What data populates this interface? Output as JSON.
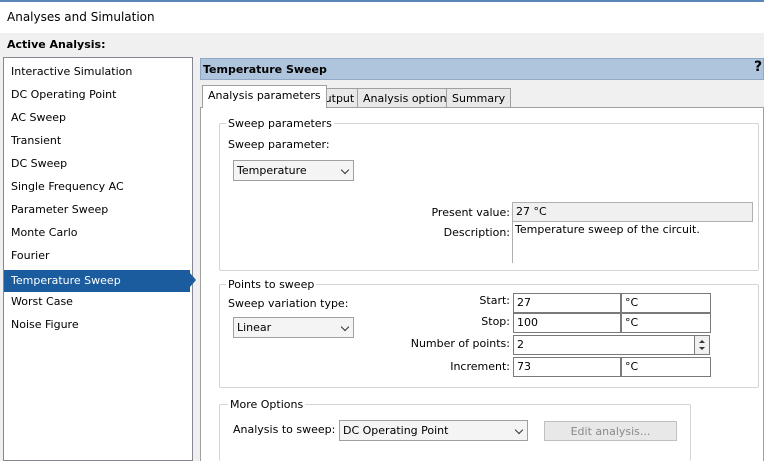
{
  "window": {
    "title": "Analyses and Simulation"
  },
  "active_analysis_label": "Active Analysis:",
  "analyses": [
    "Interactive Simulation",
    "DC Operating Point",
    "AC Sweep",
    "Transient",
    "DC Sweep",
    "Single Frequency AC",
    "Parameter Sweep",
    "Monte Carlo",
    "Fourier",
    "Temperature Sweep",
    "Worst Case",
    "Noise Figure"
  ],
  "selected_analysis": "Temperature Sweep",
  "panel": {
    "title": "Temperature Sweep",
    "help": "?"
  },
  "tabs": [
    "Analysis parameters",
    "Output",
    "Analysis options",
    "Summary"
  ],
  "active_tab": "Analysis parameters",
  "sweep_parameters": {
    "group_label": "Sweep parameters",
    "param_label": "Sweep parameter:",
    "param_value": "Temperature",
    "present_label": "Present value:",
    "present_value": "27 °C",
    "description_label": "Description:",
    "description_value": "Temperature sweep of the circuit."
  },
  "points_to_sweep": {
    "group_label": "Points to sweep",
    "variation_label": "Sweep variation type:",
    "variation_value": "Linear",
    "start_label": "Start:",
    "start_value": "27",
    "start_unit": "°C",
    "stop_label": "Stop:",
    "stop_value": "100",
    "stop_unit": "°C",
    "points_label": "Number of points:",
    "points_value": "2",
    "increment_label": "Increment:",
    "increment_value": "73",
    "increment_unit": "°C"
  },
  "more_options": {
    "group_label": "More Options",
    "analysis_label": "Analysis to sweep:",
    "analysis_value": "DC Operating Point",
    "edit_button": "Edit analysis..."
  },
  "colors": {
    "selection": "#1a5c9e",
    "header": "#aec5dd"
  }
}
